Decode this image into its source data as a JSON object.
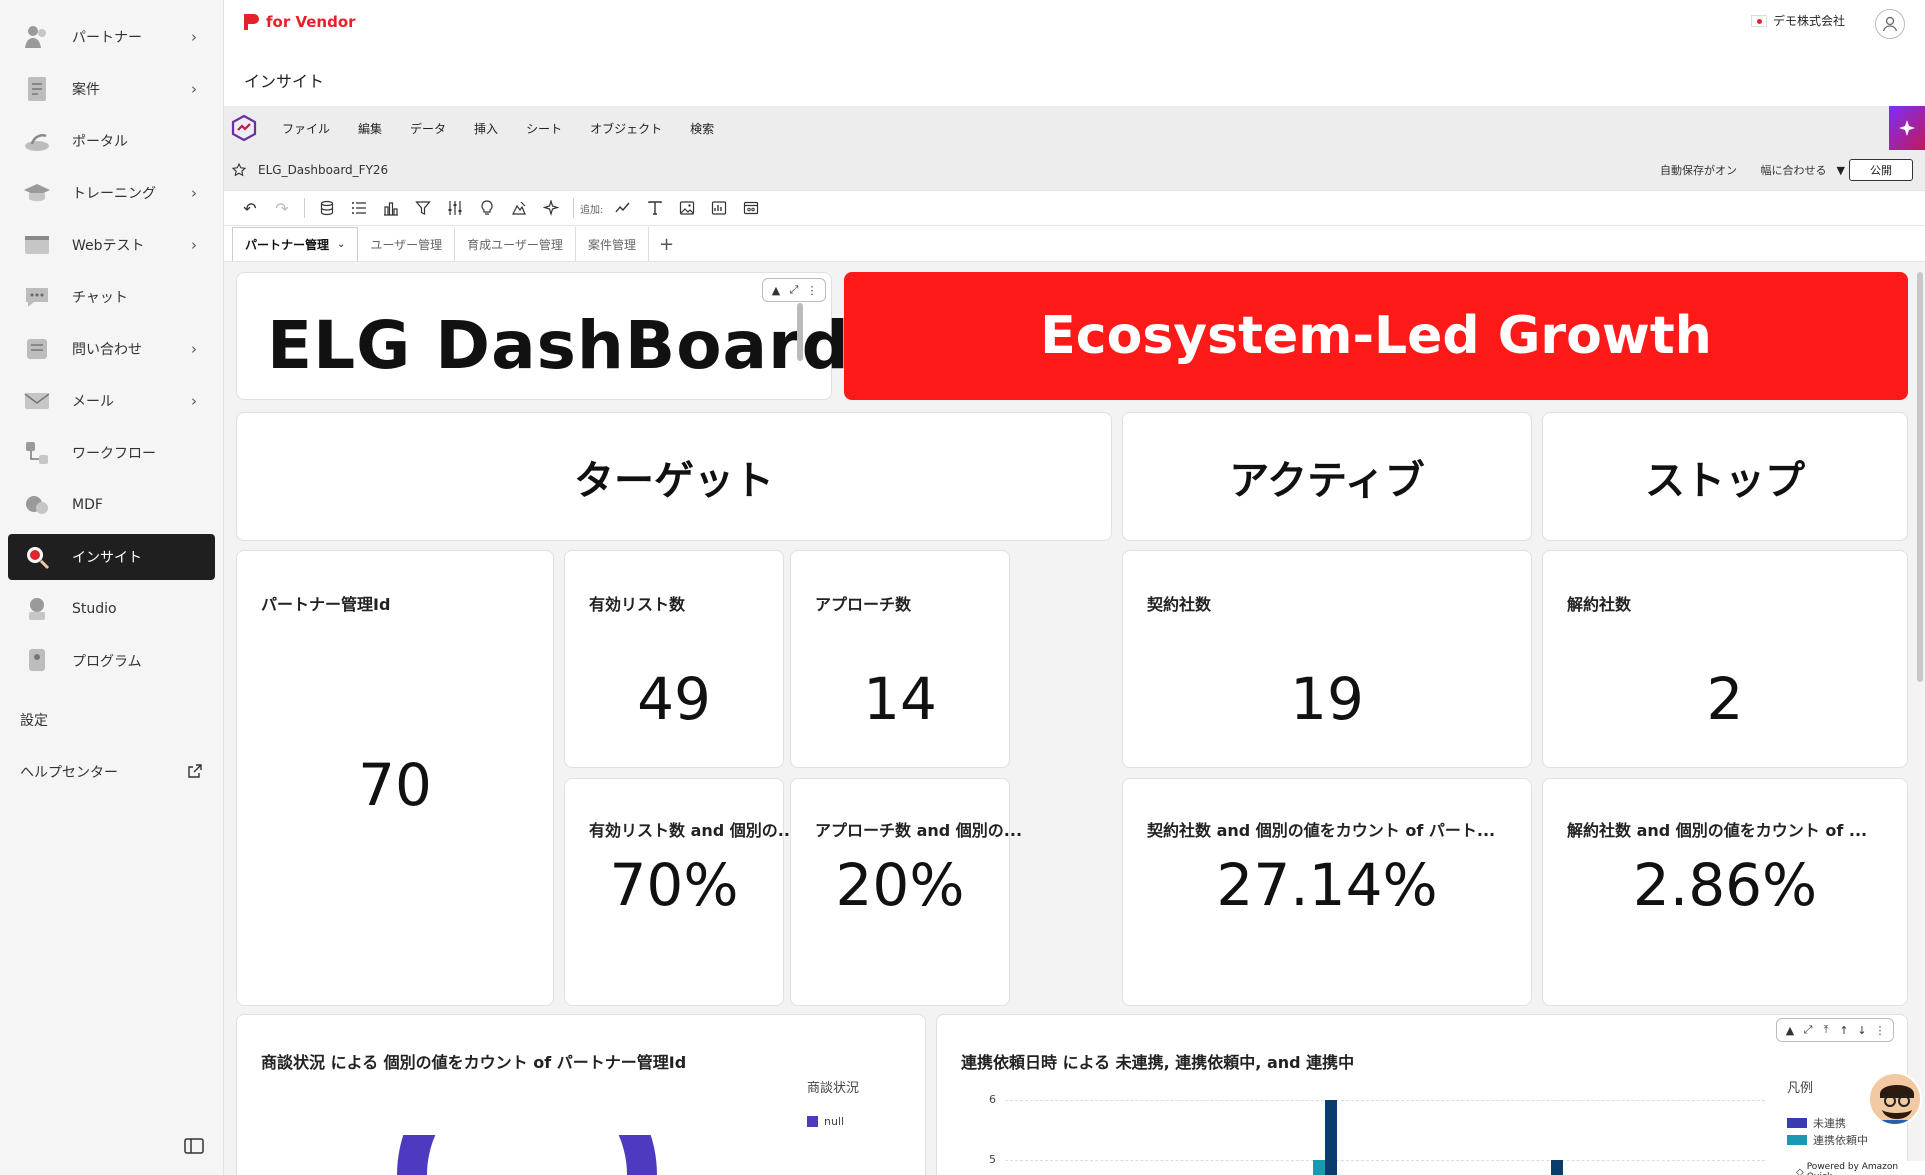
{
  "sidebar": {
    "items": [
      {
        "label": "パートナー",
        "icon": "partner-icon",
        "chevron": true
      },
      {
        "label": "案件",
        "icon": "deal-icon",
        "chevron": true
      },
      {
        "label": "ポータル",
        "icon": "portal-icon",
        "chevron": false
      },
      {
        "label": "トレーニング",
        "icon": "training-icon",
        "chevron": true
      },
      {
        "label": "Webテスト",
        "icon": "webtest-icon",
        "chevron": true
      },
      {
        "label": "チャット",
        "icon": "chat-icon",
        "chevron": false
      },
      {
        "label": "問い合わせ",
        "icon": "inquiry-icon",
        "chevron": true
      },
      {
        "label": "メール",
        "icon": "mail-icon",
        "chevron": true
      },
      {
        "label": "ワークフロー",
        "icon": "workflow-icon",
        "chevron": false
      },
      {
        "label": "MDF",
        "icon": "mdf-icon",
        "chevron": false
      },
      {
        "label": "インサイト",
        "icon": "insight-icon",
        "chevron": false,
        "active": true
      },
      {
        "label": "Studio",
        "icon": "studio-icon",
        "chevron": false
      },
      {
        "label": "プログラム",
        "icon": "program-icon",
        "chevron": false
      }
    ],
    "settings": "設定",
    "help": "ヘルプセンター"
  },
  "header": {
    "brand": "for Vendor",
    "company": "デモ株式会社",
    "page_title": "インサイト"
  },
  "menubar": {
    "items": [
      "ファイル",
      "編集",
      "データ",
      "挿入",
      "シート",
      "オブジェクト",
      "検索"
    ]
  },
  "docbar": {
    "doc_name": "ELG_Dashboard_FY26",
    "autosave": "自動保存がオン",
    "fit": "幅に合わせる",
    "publish": "公開"
  },
  "toolbar": {
    "add_label": "追加:"
  },
  "tabs": [
    "パートナー管理",
    "ユーザー管理",
    "育成ユーザー管理",
    "案件管理"
  ],
  "dashboard": {
    "title": "ELG DashBoard",
    "banner": "Ecosystem-Led Growth",
    "sections": [
      "ターゲット",
      "アクティブ",
      "ストップ"
    ],
    "partner_id": {
      "title": "パートナー管理Id",
      "value": "70"
    },
    "kpis": [
      {
        "title": "有効リスト数",
        "value": "49",
        "pct_title": "有効リスト数 and 個別の...",
        "pct": "70%"
      },
      {
        "title": "アプローチ数",
        "value": "14",
        "pct_title": "アプローチ数 and 個別の...",
        "pct": "20%"
      },
      {
        "title": "契約社数",
        "value": "19",
        "pct_title": "契約社数 and 個別の値をカウント of パート...",
        "pct": "27.14%"
      },
      {
        "title": "解約社数",
        "value": "2",
        "pct_title": "解約社数 and 個別の値をカウント of ...",
        "pct": "2.86%"
      }
    ],
    "pie_chart": {
      "title": "商談状況 による 個別の値をカウント of パートナー管理Id",
      "legend_title": "商談状況",
      "legend": [
        "null"
      ]
    },
    "bar_chart": {
      "title": "連携依頼日時 による 未連携, 連携依頼中, and 連携中",
      "legend_title": "凡例",
      "legend": [
        "未連携",
        "連携依頼中"
      ],
      "y_ticks": [
        "6",
        "5"
      ]
    },
    "powered": "Powered by Amazon Quick"
  },
  "colors": {
    "accent": "#e8202a",
    "banner": "#ff1a1a",
    "active_nav": "#1f1f1f",
    "pie": "#4c3bc0",
    "bar_dark": "#0a3d6b",
    "bar_teal": "#1a9ab0"
  }
}
